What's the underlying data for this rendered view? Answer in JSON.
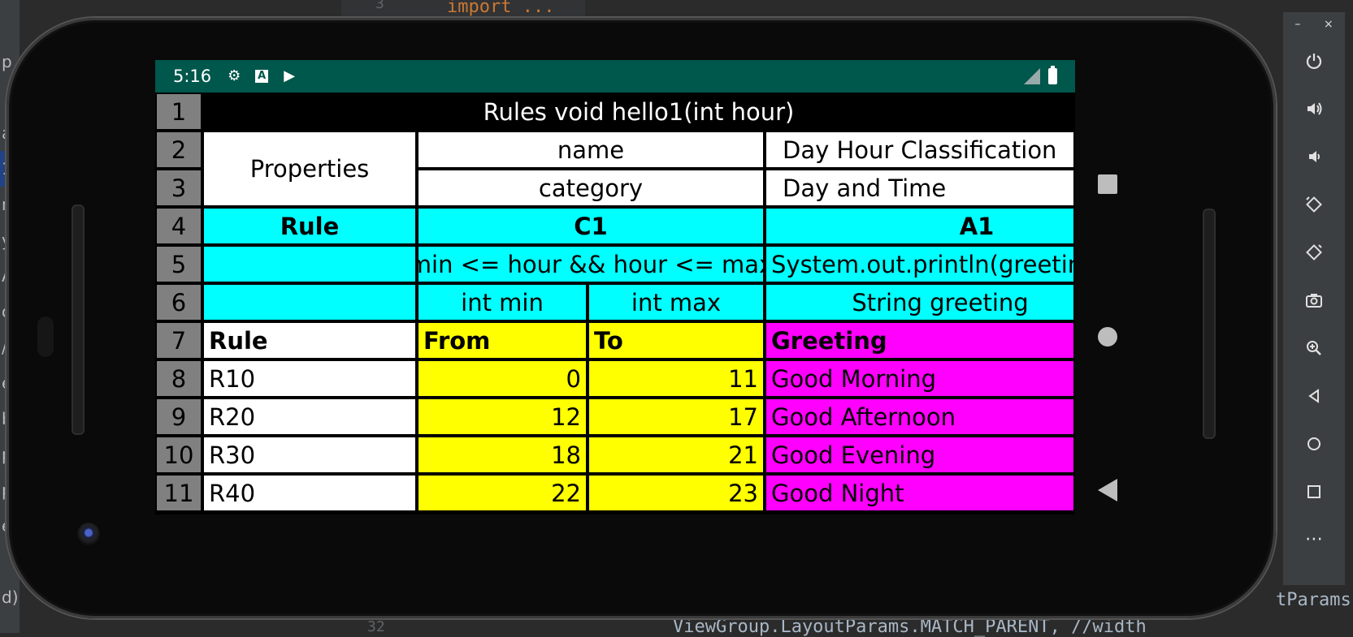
{
  "ide": {
    "line_top": "3",
    "line_bottom": "32",
    "code_top": "import ...",
    "code_bottom": "ViewGroup.LayoutParams.MATCH_PARENT, //width",
    "code_right": "tParams",
    "left_chars": [
      "p",
      "",
      "a",
      "1",
      "ni",
      "y",
      "A",
      "o",
      "/",
      "e",
      "b",
      "p",
      "p",
      "e",
      "",
      "d)"
    ]
  },
  "statusbar": {
    "time": "5:16",
    "icons": [
      "gear-icon",
      "a-icon",
      "play-store-icon"
    ]
  },
  "table": {
    "row_numbers": [
      "1",
      "2",
      "3",
      "4",
      "5",
      "6",
      "7",
      "8",
      "9",
      "10",
      "11"
    ],
    "title": "Rules void hello1(int hour)",
    "properties_label": "Properties",
    "name_label": "name",
    "name_value": "Day Hour Classification",
    "category_label": "category",
    "category_value": "Day and Time",
    "rule_header": "Rule",
    "c1_header": "C1",
    "a1_header": "A1",
    "condition_expr": "min <= hour && hour <= max",
    "action_expr": "System.out.println(greetin",
    "param_min": "int min",
    "param_max": "int max",
    "param_greeting": "String greeting",
    "col_rule": "Rule",
    "col_from": "From",
    "col_to": "To",
    "col_greeting": "Greeting",
    "rows": [
      {
        "rule": "R10",
        "from": "0",
        "to": "11",
        "greeting": "Good Morning"
      },
      {
        "rule": "R20",
        "from": "12",
        "to": "17",
        "greeting": "Good Afternoon"
      },
      {
        "rule": "R30",
        "from": "18",
        "to": "21",
        "greeting": "Good Evening"
      },
      {
        "rule": "R40",
        "from": "22",
        "to": "23",
        "greeting": "Good Night"
      }
    ]
  },
  "emulator": {
    "minimize": "–",
    "close": "×",
    "more": "⋯"
  }
}
